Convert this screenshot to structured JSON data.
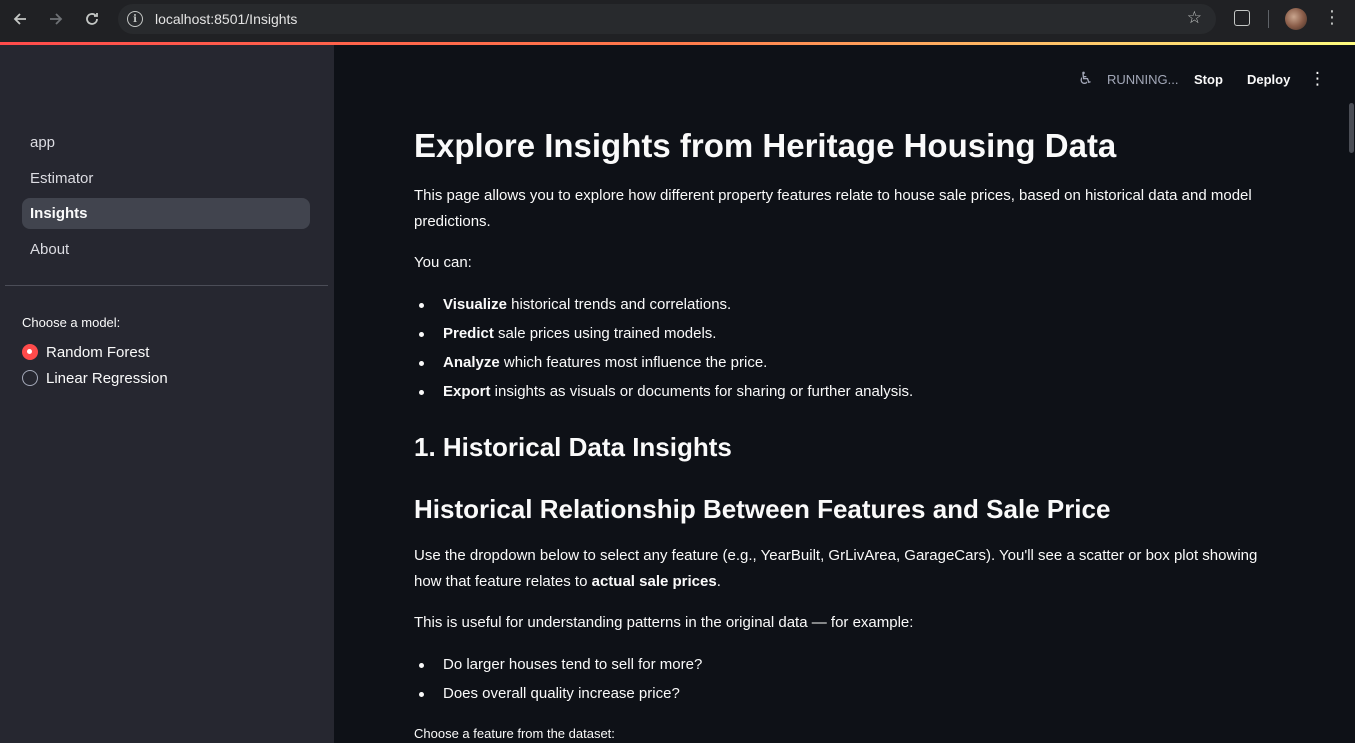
{
  "browser": {
    "url": "localhost:8501/Insights",
    "back_icon": "arrow-left-icon",
    "forward_icon": "arrow-right-icon",
    "reload_icon": "reload-icon"
  },
  "sidebar": {
    "nav": [
      {
        "label": "app",
        "active": false
      },
      {
        "label": "Estimator",
        "active": false
      },
      {
        "label": "Insights",
        "active": true
      },
      {
        "label": "About",
        "active": false
      }
    ],
    "model_label": "Choose a model:",
    "models": [
      {
        "label": "Random Forest",
        "checked": true
      },
      {
        "label": "Linear Regression",
        "checked": false
      }
    ]
  },
  "toolbar": {
    "status": "RUNNING...",
    "stop": "Stop",
    "deploy": "Deploy"
  },
  "main": {
    "title": "Explore Insights from Heritage Housing Data",
    "intro": "This page allows you to explore how different property features relate to house sale prices, based on historical data and model predictions.",
    "you_can": "You can:",
    "bullets": [
      {
        "bold": "Visualize",
        "rest": " historical trends and correlations."
      },
      {
        "bold": "Predict",
        "rest": " sale prices using trained models."
      },
      {
        "bold": "Analyze",
        "rest": " which features most influence the price."
      },
      {
        "bold": "Export",
        "rest": " insights as visuals or documents for sharing or further analysis."
      }
    ],
    "section1": "1. Historical Data Insights",
    "section1_sub": "Historical Relationship Between Features and Sale Price",
    "dropdown_text_a": "Use the dropdown below to select any feature (e.g., YearBuilt, GrLivArea, GarageCars). You'll see a scatter or box plot showing how that feature relates to ",
    "dropdown_text_bold": "actual sale prices",
    "dropdown_text_end": ".",
    "useful_text": "This is useful for understanding patterns in the original data — for example:",
    "questions": [
      "Do larger houses tend to sell for more?",
      "Does overall quality increase price?"
    ],
    "feature_label": "Choose a feature from the dataset:"
  },
  "colors": {
    "accent": "#ff4b4b",
    "sidebar_bg": "#262730",
    "main_bg": "#0e1117"
  }
}
